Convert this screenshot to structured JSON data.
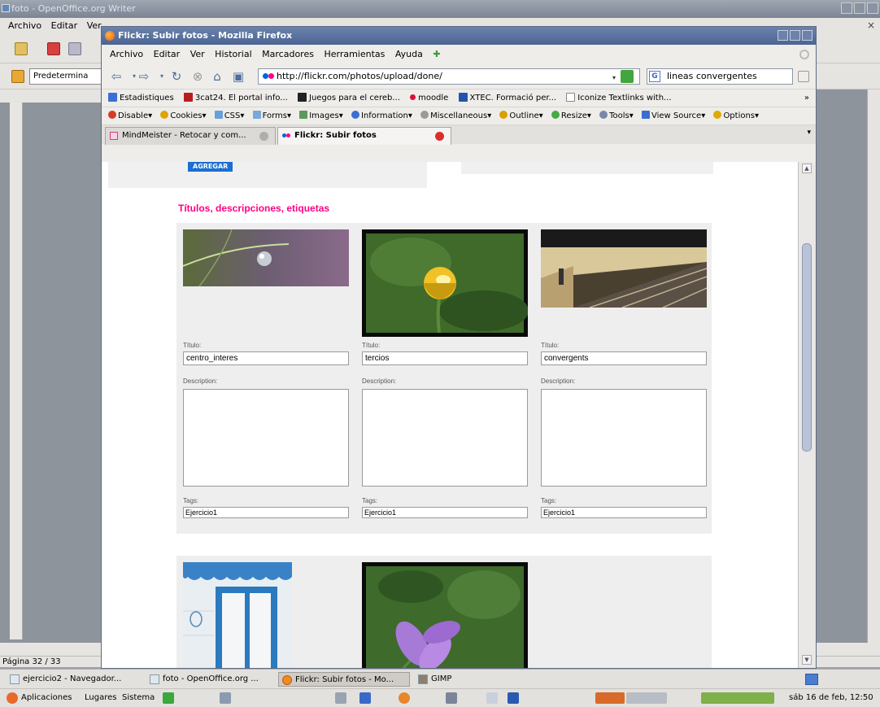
{
  "openoffice": {
    "title": "foto - OpenOffice.org Writer",
    "menu": [
      "Archivo",
      "Editar",
      "Ver"
    ],
    "paragraph_style": "Predetermina",
    "status_page": "Página 32 / 33"
  },
  "firefox": {
    "title": "Flickr: Subir fotos - Mozilla Firefox",
    "menu": [
      "Archivo",
      "Editar",
      "Ver",
      "Historial",
      "Marcadores",
      "Herramientas",
      "Ayuda"
    ],
    "url": "http://flickr.com/photos/upload/done/",
    "search_value": "lineas convergentes",
    "bookmarks": [
      {
        "label": "Estadistiques",
        "color": "#3b6fd6"
      },
      {
        "label": "3cat24. El portal info...",
        "color": "#b81d1d"
      },
      {
        "label": "Juegos para el cereb...",
        "color": "#222222"
      },
      {
        "label": "moodle",
        "color": "#d8103e"
      },
      {
        "label": "XTEC. Formació per...",
        "color": "#2255aa"
      },
      {
        "label": "Iconize Textlinks with...",
        "color": "#ffffff"
      }
    ],
    "bookmarks_more": "»",
    "devbar": [
      {
        "label": "Disable",
        "color": "#d83a2a"
      },
      {
        "label": "Cookies",
        "color": "#e0a400"
      },
      {
        "label": "CSS",
        "color": "#6aa0d8"
      },
      {
        "label": "Forms",
        "color": "#7aa8d8"
      },
      {
        "label": "Images",
        "color": "#5a9a5a"
      },
      {
        "label": "Information",
        "color": "#3a6fd0"
      },
      {
        "label": "Miscellaneous",
        "color": "#9a9a9a"
      },
      {
        "label": "Outline",
        "color": "#d8a000"
      },
      {
        "label": "Resize",
        "color": "#44aa44"
      },
      {
        "label": "Tools",
        "color": "#7a88a8"
      },
      {
        "label": "View Source",
        "color": "#3a6fd0"
      },
      {
        "label": "Options",
        "color": "#e0a800"
      }
    ],
    "tabs": [
      {
        "label": "MindMeister - Retocar y com...",
        "active": false
      },
      {
        "label": "Flickr: Subir fotos",
        "active": true
      }
    ]
  },
  "flickr": {
    "add_button": "AGREGAR",
    "section_title": "Títulos, descripciones, etiquetas",
    "photos": [
      {
        "title_label": "Título:",
        "title": "centro_interes",
        "desc_label": "Description:",
        "tags_label": "Tags:",
        "tags": "Ejercicio1"
      },
      {
        "title_label": "Título:",
        "title": "tercios",
        "desc_label": "Description:",
        "tags_label": "Tags:",
        "tags": "Ejercicio1"
      },
      {
        "title_label": "Título:",
        "title": "convergents",
        "desc_label": "Description:",
        "tags_label": "Tags:",
        "tags": "Ejercicio1"
      }
    ]
  },
  "taskbar": {
    "items": [
      {
        "label": "ejercicio2 - Navegador...",
        "active": false
      },
      {
        "label": "foto - OpenOffice.org ...",
        "active": false
      },
      {
        "label": "Flickr: Subir fotos - Mo...",
        "active": true
      },
      {
        "label": "GIMP",
        "active": false
      }
    ]
  },
  "panel": {
    "applications": "Aplicaciones",
    "places": "Lugares",
    "system": "Sistema",
    "clock": "sáb 16 de feb, 12:50"
  },
  "colors": {
    "flickr_pink": "#ff0084",
    "flickr_blue": "#0063dc",
    "titlebar_blue": "#4b6493"
  }
}
